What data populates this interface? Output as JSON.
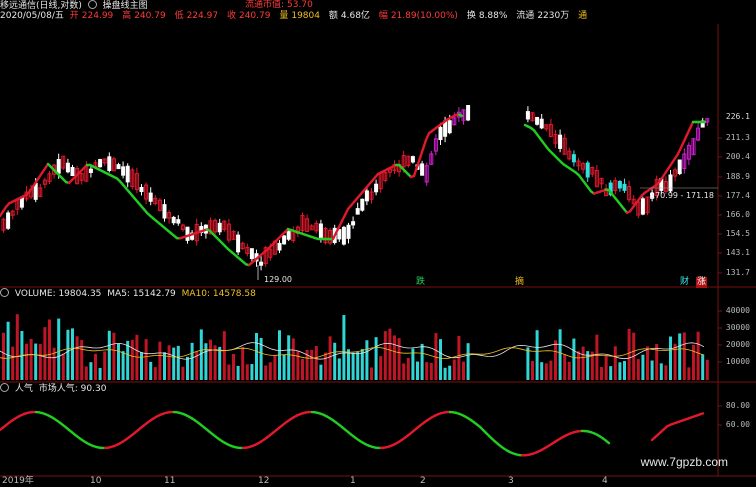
{
  "header": {
    "name_clip": "移远通信(日线,对数)",
    "icon1": "gear-icon",
    "indicator": "操盘线主图",
    "float_mkt_label": "流通市值:",
    "float_mkt_value": "53.70",
    "date": "2020/05/08/五",
    "open_label": "开",
    "open": "224.99",
    "high_label": "高",
    "high": "240.79",
    "low_label": "低",
    "low": "224.97",
    "close_label": "收",
    "close": "240.79",
    "vol_label": "量",
    "vol": "19804",
    "amt_label": "额",
    "amt": "4.68亿",
    "chg_label": "幅",
    "chg": "21.89(10.00%)",
    "turn_label": "换",
    "turn": "8.88%",
    "float_label": "流通",
    "float": "2230万",
    "clip": "通"
  },
  "price_axis": [
    "211.3",
    "200.4",
    "188.9",
    "177.4",
    "166.0",
    "154.5",
    "143.1",
    "131.7"
  ],
  "price_top_tick": "226.1",
  "annotations": {
    "low_mark": "129.00",
    "range": "170.99 - 171.18",
    "tag_die": "跌",
    "tag_zhai": "摘",
    "tag_cai": "财",
    "tag_zhang": "涨"
  },
  "volume_header": {
    "label": "VOLUME: 19804.35",
    "ma5": "MA5: 15142.79",
    "ma10": "MA10: 14578.58"
  },
  "volume_axis": [
    "40000",
    "30000",
    "20000",
    "10000"
  ],
  "sentiment_header": {
    "label": "人气",
    "value": "市场人气: 90.30"
  },
  "sentiment_axis": [
    "80.00",
    "60.00"
  ],
  "time_axis": [
    "2019年",
    "10",
    "11",
    "12",
    "1",
    "2",
    "3",
    "4"
  ],
  "watermark": "www.7gpzb.com",
  "colors": {
    "up": "#e0192c",
    "down": "#33e0e0",
    "ma_up": "#e0192c",
    "ma_down": "#22cc22",
    "ma5": "#e6e6e6",
    "ma10": "#f0c020",
    "magenta": "#d020d0"
  }
}
